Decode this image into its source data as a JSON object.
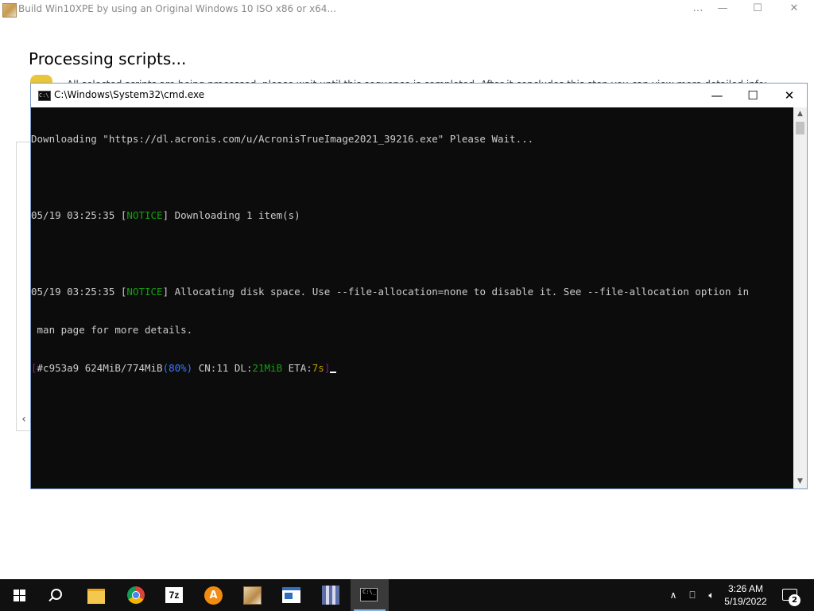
{
  "bg_window": {
    "title": "Build Win10XPE by using an Original Windows 10 ISO x86 or x64...",
    "controls": {
      "minimize": "…",
      "maximize": "☐",
      "close": "✕"
    },
    "heading": "Processing scripts...",
    "description": "All selected scripts are being processed, please wait until this sequence is completed. After it concludes this step you can view more detailed information inside",
    "scroll_left": "‹"
  },
  "cmd_window": {
    "title": "C:\\Windows\\System32\\cmd.exe",
    "icon_label": "C:\\",
    "controls": {
      "minimize": "—",
      "maximize": "☐",
      "close": "✕"
    },
    "lines": {
      "downloading": "Downloading \"https://dl.acronis.com/u/AcronisTrueImage2021_39216.exe\" Please Wait...",
      "notice1_time": "05/19 03:25:35 ",
      "notice1_open": "[",
      "notice1_tag": "NOTICE",
      "notice1_close": "]",
      "notice1_text": " Downloading 1 item(s)",
      "notice2_time": "05/19 03:25:35 ",
      "notice2_open": "[",
      "notice2_tag": "NOTICE",
      "notice2_close": "]",
      "notice2_text": " Allocating disk space. Use --file-allocation=none to disable it. See --file-allocation option in",
      "notice2_cont": " man page for more details.",
      "progress_open": "[",
      "progress_gid": "#c953a9 624MiB/774MiB",
      "progress_pct": "(80%)",
      "progress_cn": " CN:11 DL:",
      "progress_dl": "21MiB",
      "progress_eta_label": " ETA:",
      "progress_eta": "7s",
      "progress_close": "]"
    },
    "download_progress_pct": 80,
    "scroll_up": "▲",
    "scroll_down": "▼"
  },
  "taskbar": {
    "icons": [
      "windows-start-icon",
      "search-icon",
      "file-explorer-icon",
      "chrome-icon",
      "7zip-icon",
      "acronis-icon",
      "win10xpe-builder-icon",
      "windows-app-icon",
      "split-app-icon",
      "cmd-icon"
    ],
    "sevenz_label": "7z",
    "cmd_icon_label": "C:\\_",
    "tray": {
      "chevron": "∧",
      "network": "⎕",
      "volume": "🔈︎"
    },
    "time": "3:26 AM",
    "date": "5/19/2022",
    "notification_count": "2"
  },
  "colors": {
    "console_bg": "#0c0c0c",
    "console_text": "#cccccc",
    "notice_green": "#13a10e",
    "pct_blue": "#3b78ff",
    "eta_yellow": "#c19c00",
    "bracket_magenta": "#881798",
    "taskbar_bg": "#101010"
  }
}
